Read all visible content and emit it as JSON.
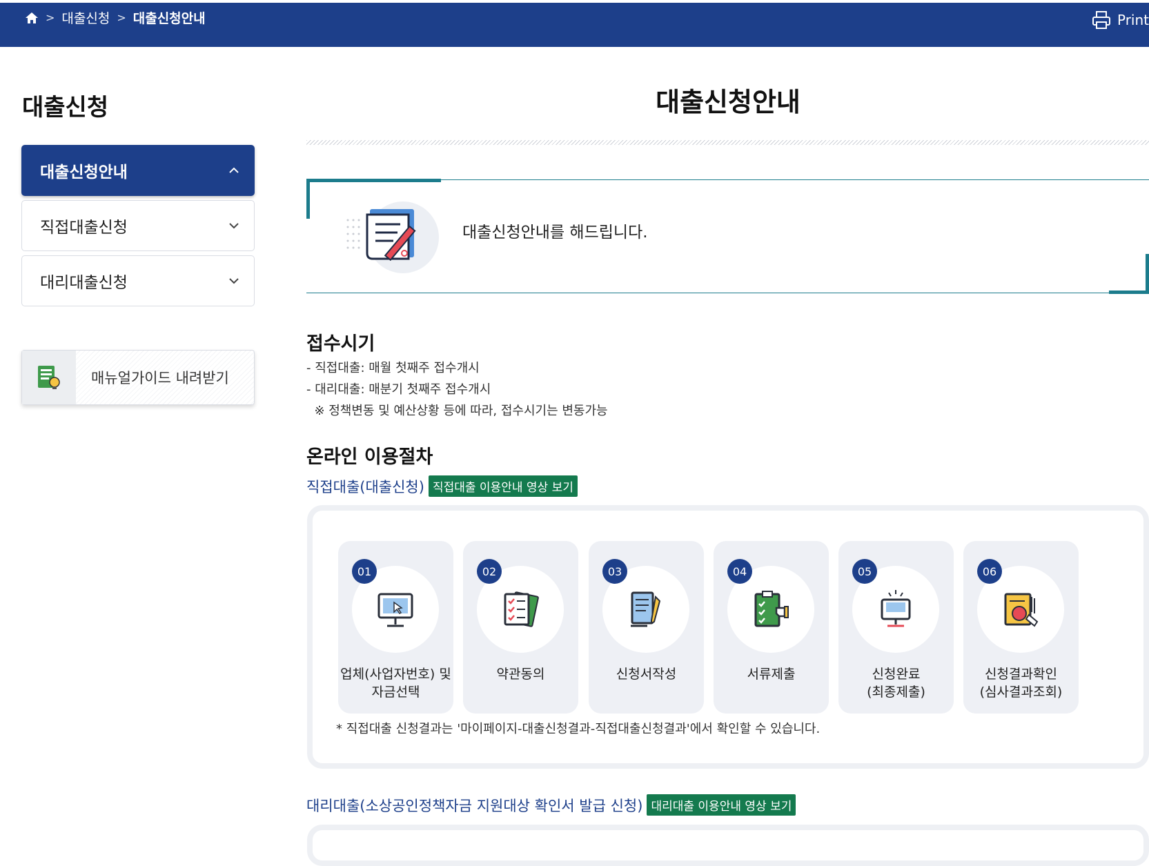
{
  "colors": {
    "nav": "#1d3f8a",
    "teal": "#1c7c8c",
    "video_badge": "#147a4e",
    "step_bg": "#eef0f5"
  },
  "breadcrumb": {
    "home_icon": "home-icon",
    "level1": "대출신청",
    "level2": "대출신청안내",
    "sep": ">"
  },
  "print_label": "Print",
  "sidebar": {
    "title": "대출신청",
    "items": [
      {
        "label": "대출신청안내",
        "state": "expanded"
      },
      {
        "label": "직접대출신청",
        "state": "collapsed"
      },
      {
        "label": "대리대출신청",
        "state": "collapsed"
      }
    ],
    "manual_button": "매뉴얼가이드 내려받기"
  },
  "main": {
    "title": "대출신청안내",
    "intro_text": "대출신청안내를 해드립니다.",
    "reception": {
      "heading": "접수시기",
      "lines": [
        "- 직접대출: 매월 첫째주 접수개시",
        "- 대리대출: 매분기 첫째주 접수개시",
        "  ※ 정책변동 및 예산상황 등에 따라, 접수시기는 변동가능"
      ]
    },
    "procedure": {
      "heading": "온라인 이용절차",
      "direct": {
        "title": "직접대출(대출신청)",
        "video": "직접대출 이용안내 영상 보기",
        "steps": [
          {
            "num": "01",
            "label": "업체(사업자번호) 및\n자금선택",
            "icon": "computer-select-icon"
          },
          {
            "num": "02",
            "label": "약관동의",
            "icon": "agreement-documents-icon"
          },
          {
            "num": "03",
            "label": "신청서작성",
            "icon": "write-application-icon"
          },
          {
            "num": "04",
            "label": "서류제출",
            "icon": "submit-documents-icon"
          },
          {
            "num": "05",
            "label": "신청완료\n(최종제출)",
            "icon": "application-complete-icon"
          },
          {
            "num": "06",
            "label": "신청결과확인\n(심사결과조회)",
            "icon": "result-check-icon"
          }
        ],
        "note": "* 직접대출 신청결과는 '마이페이지-대출신청결과-직접대출신청결과'에서 확인할 수 있습니다."
      },
      "agent": {
        "title": "대리대출(소상공인정책자금 지원대상 확인서 발급 신청)",
        "video": "대리대출 이용안내 영상 보기"
      }
    }
  }
}
